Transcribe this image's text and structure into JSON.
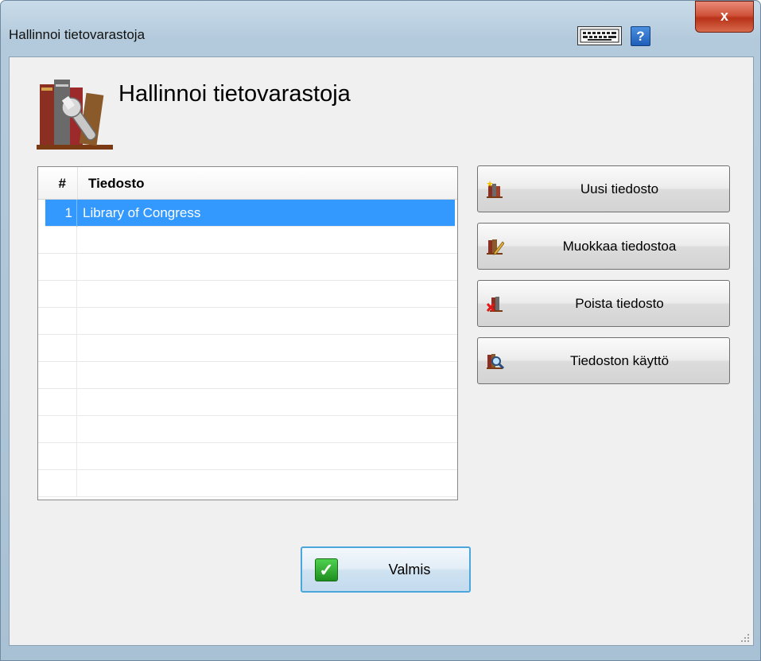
{
  "window": {
    "title": "Hallinnoi tietovarastoja",
    "close_label": "x",
    "help_label": "?"
  },
  "header": {
    "title": "Hallinnoi tietovarastoja"
  },
  "list": {
    "columns": {
      "num": "#",
      "file": "Tiedosto"
    },
    "rows": [
      {
        "num": "1",
        "file": "Library of Congress",
        "selected": true
      },
      {
        "num": "",
        "file": ""
      },
      {
        "num": "",
        "file": ""
      },
      {
        "num": "",
        "file": ""
      },
      {
        "num": "",
        "file": ""
      },
      {
        "num": "",
        "file": ""
      },
      {
        "num": "",
        "file": ""
      },
      {
        "num": "",
        "file": ""
      },
      {
        "num": "",
        "file": ""
      },
      {
        "num": "",
        "file": ""
      },
      {
        "num": "",
        "file": ""
      }
    ]
  },
  "actions": {
    "new": "Uusi tiedosto",
    "edit": "Muokkaa tiedostoa",
    "delete": "Poista tiedosto",
    "usage": "Tiedoston käyttö"
  },
  "footer": {
    "done": "Valmis"
  },
  "colors": {
    "selection": "#3399ff",
    "done_border": "#4ba6dc",
    "close_red": "#c8402a"
  }
}
